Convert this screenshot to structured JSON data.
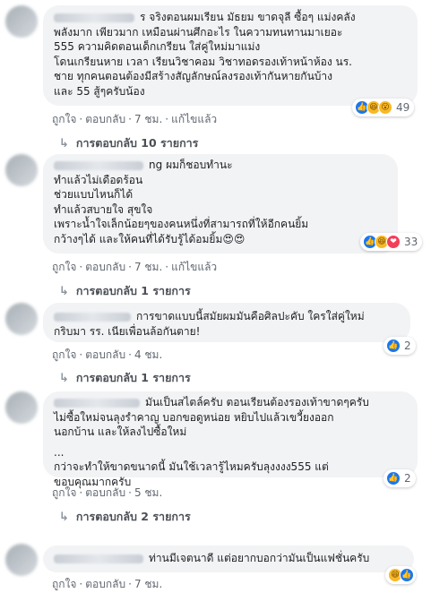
{
  "comments": [
    {
      "name": "ร",
      "lines": [
        "จริงตอนผมเรียน มัธยม ขาดจุลี ซื้อๆ แม่งคลัง",
        "พลังมาก เพียวมาก เหมือนผ่านศึกอะไร ในความทนทานมาเยอะ",
        "555 ความคิดตอนเด็กเกรียน ใส่คู่ใหม่มาแม่ง",
        "โดนเกรียนหาย เวลา เรียนวิชาคอม วิชาทอดรองเท้าหน้าห้อง นร.",
        "ชาย ทุกคนตอนต้องมีสร้างสัญลักษณ์ลงรองเท้ากันหายกันบ้าง",
        "และ 55 สู้ๆครับน้อง"
      ],
      "reactions": {
        "icons": [
          "like-icon",
          "haha-icon",
          "wow-icon"
        ],
        "count": "49"
      },
      "actions": {
        "like": "ถูกใจ",
        "reply": "ตอบกลับ",
        "time": "7 ชม.",
        "edited": "แก้ไขแล้ว"
      },
      "replies": "การตอบกลับ 10 รายการ"
    },
    {
      "name": "ng",
      "lines": [
        "ผมก็ชอบทำนะ",
        "ทำแล้วไม่เดือดร้อน",
        "ช่วยแบบไหนก็ได้",
        "ทำแล้วสบายใจ สุขใจ",
        "เพราะน้ำใจเล็กน้อยๆของคนหนึ่งที่สามารถที่ให้อีกคนยิ้ม",
        "กว้างๆได้ และให้คนที่ได้รับรู้ได้อมยิ้ม😍😍"
      ],
      "reactions": {
        "icons": [
          "like-icon",
          "haha-icon",
          "love-icon"
        ],
        "count": "33"
      },
      "actions": {
        "like": "ถูกใจ",
        "reply": "ตอบกลับ",
        "time": "7 ชม.",
        "edited": "แก้ไขแล้ว"
      },
      "replies": "การตอบกลับ 1 รายการ"
    },
    {
      "name": "",
      "lines": [
        "การขาดแบบนี้สมัยผมมันคือศิลปะคับ ใครใส่คู่ใหม่",
        "กริบมา รร. เนียเพื่อนล้อกันตาย!"
      ],
      "reactions": {
        "icons": [
          "like-icon"
        ],
        "count": "2"
      },
      "actions": {
        "like": "ถูกใจ",
        "reply": "ตอบกลับ",
        "time": "4 ชม."
      },
      "replies": "การตอบกลับ 1 รายการ"
    },
    {
      "name": "",
      "lines": [
        "มันเป็นสไตล์ครับ ตอนเรียนต้องรองเท้าขาดๆครับ",
        "ไม่ซื้อใหม่จนลุงรำคาญ บอกขอดูหน่อย หยิบไปแล้วเขวี้ยงออก",
        "นอกบ้าน และให้ลงไปซื้อใหม่",
        "...",
        "กว่าจะทำให้ขาดขนาดนี้ มันใช้เวลารู้ไหมครับลุงงงง555 แต่",
        "ขอบคุณมากครับ"
      ],
      "reactions": {
        "icons": [
          "like-icon"
        ],
        "count": "2"
      },
      "actions": {
        "like": "ถูกใจ",
        "reply": "ตอบกลับ",
        "time": "5 ชม."
      },
      "replies": "การตอบกลับ 2 รายการ"
    },
    {
      "name": "",
      "lines": [
        "ท่านมีเจตนาดี แต่อยากบอกว่ามันเป็นแฟชั่นครับ"
      ],
      "reactions": {
        "icons": [
          "haha-icon",
          "like-icon"
        ],
        "count": ""
      },
      "actions": {
        "like": "ถูกใจ",
        "reply": "ตอบกลับ",
        "time": "7 ชม."
      },
      "replies": ""
    }
  ],
  "icons": {
    "like-icon": "👍",
    "haha-icon": "😆",
    "love-icon": "❤",
    "wow-icon": "😮",
    "reply-arrow-icon": "↳"
  },
  "colors": {
    "like": "#1877f2",
    "love": "#f33e58",
    "haha": "#f7b928",
    "bubble": "#f2f3f5",
    "meta": "#606770"
  }
}
